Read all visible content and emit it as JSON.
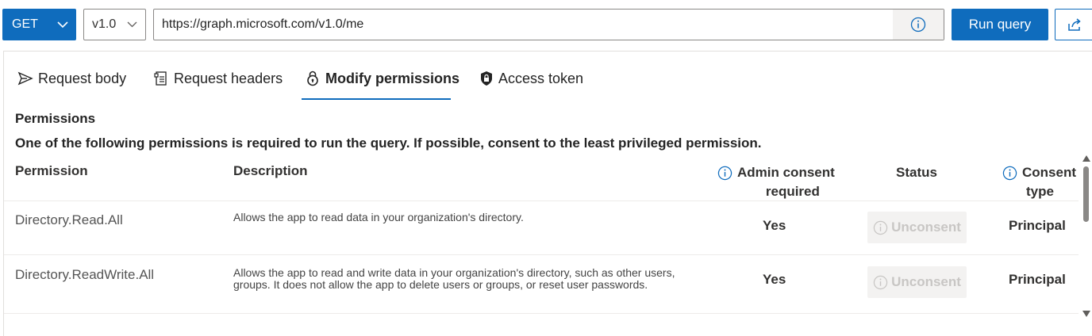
{
  "query_bar": {
    "method": "GET",
    "version": "v1.0",
    "url": "https://graph.microsoft.com/v1.0/me",
    "run_label": "Run query"
  },
  "tabs": [
    {
      "label": "Request body",
      "icon": "send-icon"
    },
    {
      "label": "Request headers",
      "icon": "document-icon"
    },
    {
      "label": "Modify permissions",
      "icon": "lock-icon",
      "active": true
    },
    {
      "label": "Access token",
      "icon": "shield-lock-icon"
    }
  ],
  "permissions": {
    "title": "Permissions",
    "description": "One of the following permissions is required to run the query. If possible, consent to the least privileged permission.",
    "columns": {
      "permission": "Permission",
      "description": "Description",
      "admin_consent_line1": "Admin consent",
      "admin_consent_line2": "required",
      "status": "Status",
      "consent_type_line1": "Consent",
      "consent_type_line2": "type"
    },
    "rows": [
      {
        "name": "Directory.Read.All",
        "description": "Allows the app to read data in your organization's directory.",
        "admin_consent": "Yes",
        "status_button": "Unconsent",
        "consent_type": "Principal"
      },
      {
        "name": "Directory.ReadWrite.All",
        "description": "Allows the app to read and write data in your organization's directory, such as other users, groups. It does not allow the app to delete users or groups, or reset user passwords.",
        "admin_consent": "Yes",
        "status_button": "Unconsent",
        "consent_type": "Principal"
      }
    ]
  },
  "colors": {
    "accent": "#0f6cbd",
    "disabled_bg": "#f3f2f1",
    "disabled_text": "#c8c6c4"
  }
}
